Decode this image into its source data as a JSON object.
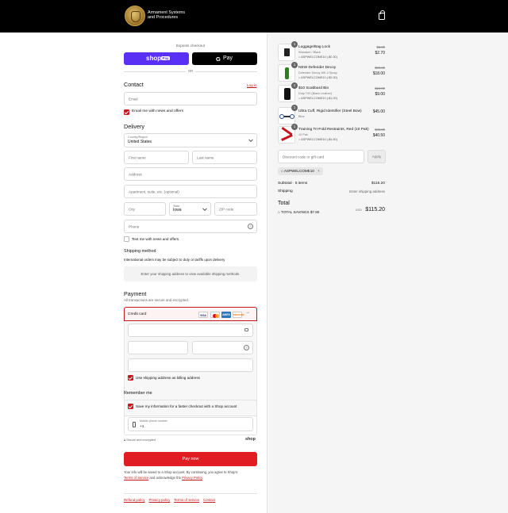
{
  "header": {
    "brand_line1": "Armament Systems",
    "brand_line2": "and Procedures"
  },
  "express": {
    "title": "Express checkout",
    "shop_pay_label": "shop",
    "shop_pay_badge": "Pay",
    "gpay_label": "Pay",
    "or": "OR"
  },
  "contact": {
    "heading": "Contact",
    "login": "Log in",
    "email_placeholder": "Email",
    "news_label": "Email me with news and offers"
  },
  "delivery": {
    "heading": "Delivery",
    "country_label": "Country/Region",
    "country_value": "United States",
    "first_name": "First name",
    "last_name": "Last name",
    "address": "Address",
    "apartment": "Apartment, suite, etc. (optional)",
    "city": "City",
    "state_label": "State",
    "state_value": "Iowa",
    "zip": "ZIP code",
    "phone": "Phone",
    "text_news": "Text me with news and offers"
  },
  "shipping": {
    "heading": "Shipping method",
    "notice": "International orders may be subject to duty or tariffs upon delivery",
    "placeholder": "Enter your shipping address to view available shipping methods."
  },
  "payment": {
    "heading": "Payment",
    "sub": "All transactions are secure and encrypted.",
    "method": "Credit card",
    "cards": [
      "VISA",
      "MC",
      "AMEX",
      "DISCOVER"
    ],
    "billing_same": "Use shipping address as billing address"
  },
  "remember": {
    "heading": "Remember me",
    "save_info": "Save my information for a faster checkout with a Shop account",
    "phone_label": "Mobile phone number",
    "phone_value": "+1",
    "secure": "Secure and encrypted",
    "shop": "shop"
  },
  "pay_now": "Pay now",
  "legal": {
    "line1": "Your info will be saved to a Shop account. By continuing, you agree to Shop's",
    "tos": "Terms of Service",
    "and": " and acknowledge the ",
    "privacy": "Privacy Policy",
    "end": "."
  },
  "footer_links": [
    "Refund policy",
    "Privacy policy",
    "Terms of service",
    "Contact"
  ],
  "cart": {
    "items": [
      {
        "qty": "1",
        "name": "Luggage/Bag Lock",
        "variant": "Standard / Black",
        "discount": "ASPWELCOME10 (-$0.30)",
        "old_price": "$3.00",
        "price": "$2.70"
      },
      {
        "qty": "1",
        "name": "NEW Defender Decoy",
        "variant": "Defender Decoy-MK-4 Spray",
        "discount": "ASPWELCOME10 (-$2.00)",
        "old_price": "$20.00",
        "price": "$18.00"
      },
      {
        "qty": "1",
        "name": "$10 Scabbard Bin",
        "variant": "Duty T40 (Black Leather)",
        "discount": "ASPWELCOME10 (-$1.00)",
        "old_price": "$10.00",
        "price": "$9.00"
      },
      {
        "qty": "1",
        "name": "Ultra Cuff, Rigid Identifier (Steel Bow)",
        "variant": "Blue",
        "discount": "",
        "old_price": "",
        "price": "$45.00"
      },
      {
        "qty": "1",
        "name": "Training Tri-Fold Restraints, Red (10 Pak)",
        "variant": "10 Pak",
        "discount": "ASPWELCOME10 (-$4.50)",
        "old_price": "$45.00",
        "price": "$40.50"
      }
    ],
    "discount_placeholder": "Discount code or gift card",
    "apply": "Apply",
    "applied_code": "ASPWELCOME10",
    "subtotal_label": "Subtotal · 5 items",
    "subtotal_value": "$115.20",
    "shipping_label": "Shipping",
    "shipping_value": "Enter shipping address",
    "total_label": "Total",
    "currency": "USD",
    "total_value": "$115.20",
    "savings_label": "TOTAL SAVINGS",
    "savings_value": "$7.80"
  },
  "colors": {
    "accent": "#c4161c",
    "shop_pay": "#5a31f4"
  }
}
